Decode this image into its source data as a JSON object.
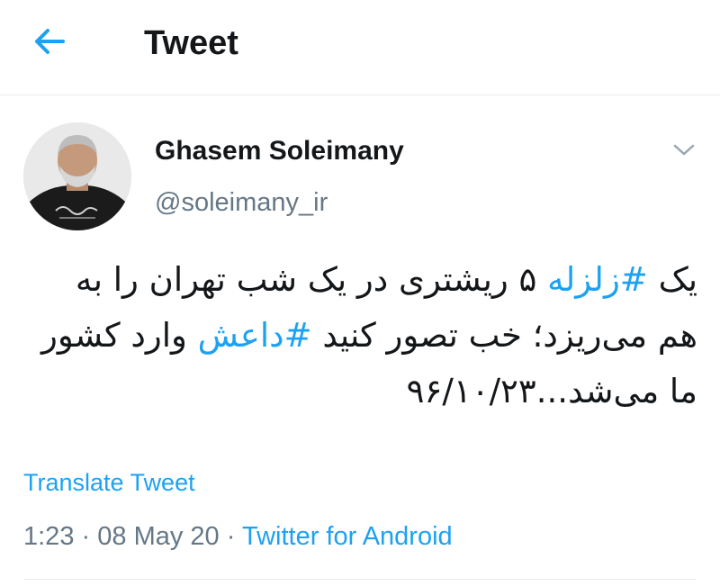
{
  "header": {
    "title": "Tweet",
    "back_icon": "arrow-left-icon",
    "accent_color": "#1da1f2"
  },
  "author": {
    "display_name": "Ghasem Soleimany",
    "handle": "@soleimany_ir",
    "avatar_icon": "profile-photo"
  },
  "tweet": {
    "segments": [
      {
        "text": "یک ",
        "hashtag": false
      },
      {
        "text": "#زلزله",
        "hashtag": true
      },
      {
        "text": " ۵ ریشتری در یک شب تهران را به هم می‌ریزد؛ خب تصور کنید ",
        "hashtag": false
      },
      {
        "text": "#داعش",
        "hashtag": true
      },
      {
        "text": " وارد کشور ما می‌شد...۹۶/۱۰/۲۳",
        "hashtag": false
      }
    ],
    "translate_label": "Translate Tweet",
    "time": "1:23",
    "separator": "·",
    "date": "08 May 20",
    "source": "Twitter for Android"
  },
  "colors": {
    "text": "#14171a",
    "secondary": "#657786",
    "link": "#1da1f2",
    "divider": "#e6ecf0"
  }
}
